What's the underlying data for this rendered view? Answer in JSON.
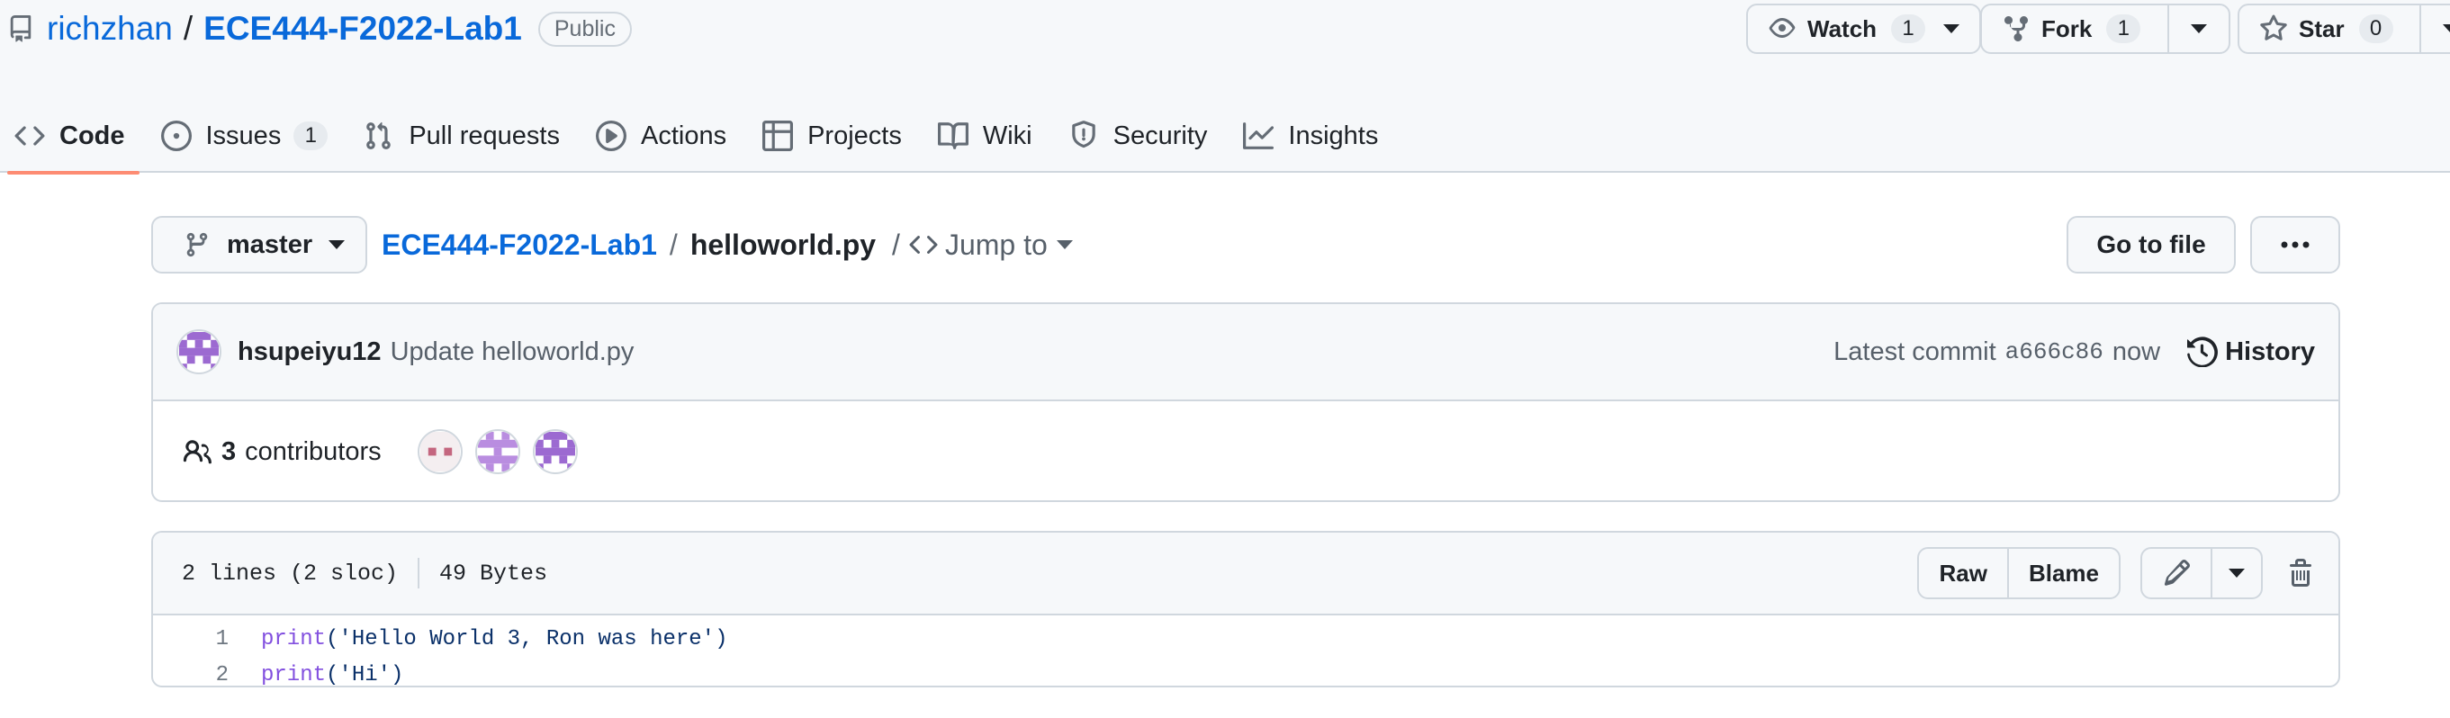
{
  "repo": {
    "owner": "richzhan",
    "separator": "/",
    "name": "ECE444-F2022-Lab1",
    "visibility": "Public"
  },
  "header_actions": {
    "watch": {
      "label": "Watch",
      "count": "1"
    },
    "fork": {
      "label": "Fork",
      "count": "1"
    },
    "star": {
      "label": "Star",
      "count": "0"
    }
  },
  "nav_tabs": [
    {
      "label": "Code",
      "icon": "code-icon",
      "selected": true
    },
    {
      "label": "Issues",
      "icon": "issue-opened-icon",
      "count": "1"
    },
    {
      "label": "Pull requests",
      "icon": "git-pull-request-icon"
    },
    {
      "label": "Actions",
      "icon": "play-icon"
    },
    {
      "label": "Projects",
      "icon": "table-icon"
    },
    {
      "label": "Wiki",
      "icon": "book-icon"
    },
    {
      "label": "Security",
      "icon": "shield-icon"
    },
    {
      "label": "Insights",
      "icon": "graph-icon"
    }
  ],
  "file_nav": {
    "branch": "master",
    "repo_link": "ECE444-F2022-Lab1",
    "separator": "/",
    "file_name": "helloworld.py",
    "jump_separator": "/",
    "jump_label": "Jump to",
    "goto_file": "Go to file"
  },
  "commit": {
    "author": "hsupeiyu12",
    "message": "Update helloworld.py",
    "latest_label": "Latest commit",
    "sha": "a666c86",
    "time": "now",
    "history_label": "History"
  },
  "contributors": {
    "count": "3",
    "label": "contributors"
  },
  "file": {
    "lines_info": "2 lines (2 sloc)",
    "size": "49 Bytes",
    "raw_label": "Raw",
    "blame_label": "Blame",
    "code": [
      {
        "num": "1",
        "fn": "print",
        "args": "('Hello World 3, Ron was here')"
      },
      {
        "num": "2",
        "fn": "print",
        "args": "('Hi')"
      }
    ]
  },
  "colors": {
    "link": "#0969da",
    "selected_tab_underline": "#fd8c73",
    "header_bg": "#f6f8fa",
    "border": "#d0d7de"
  }
}
